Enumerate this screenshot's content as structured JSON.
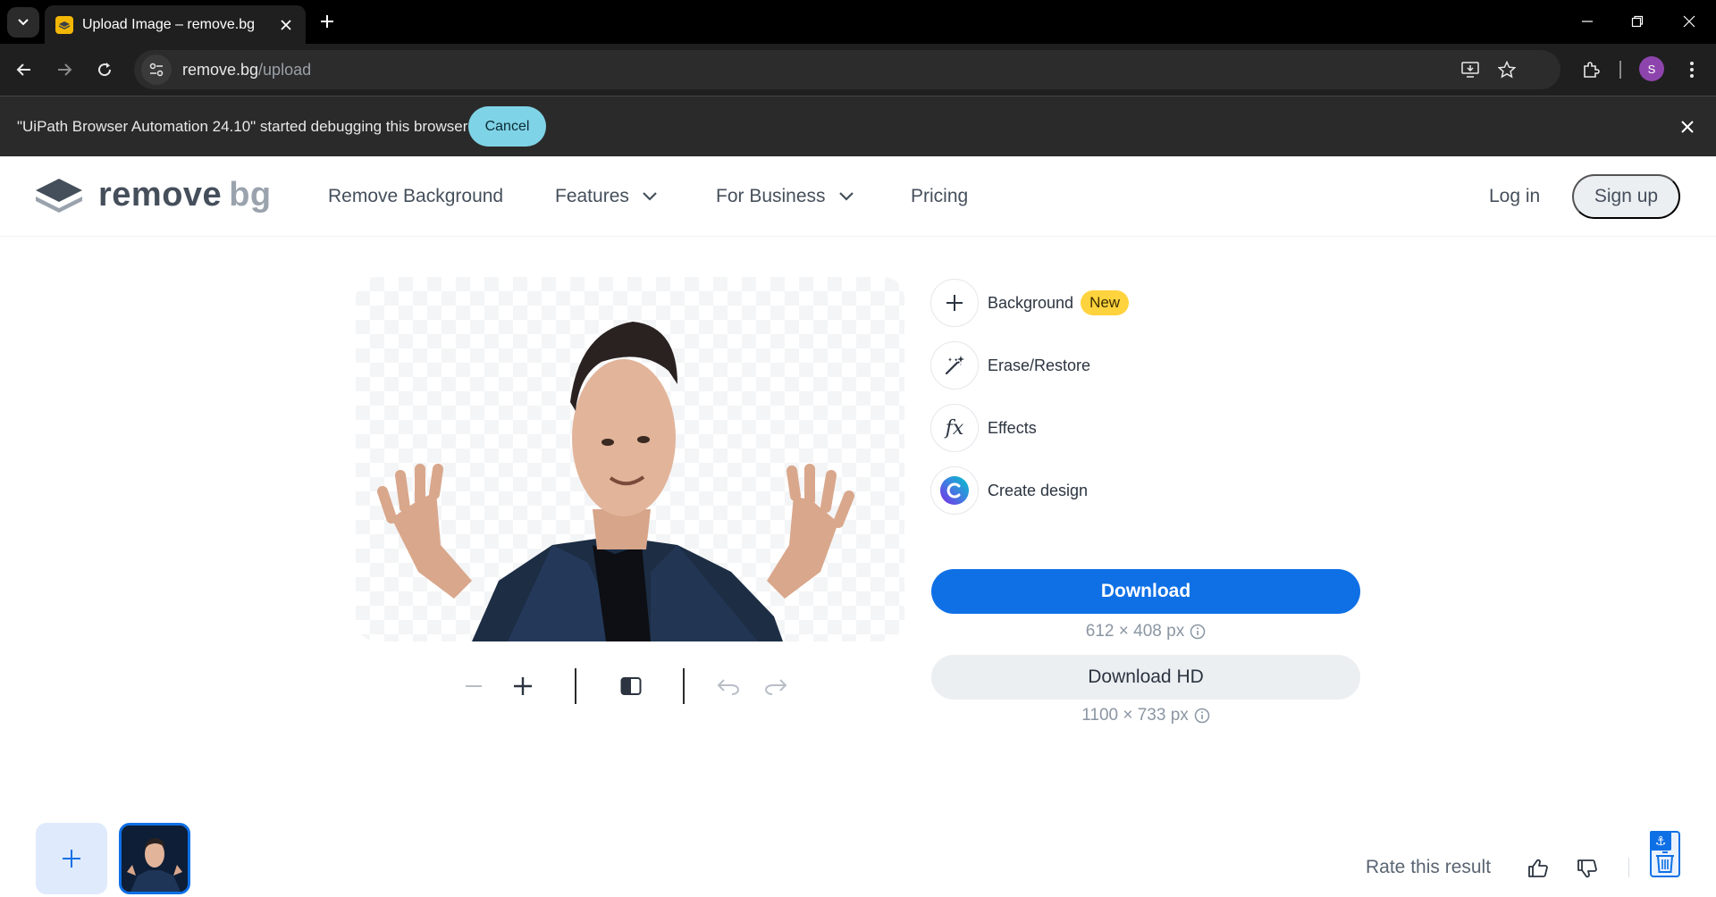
{
  "browser": {
    "tab_title": "Upload Image – remove.bg",
    "url_host": "remove.bg",
    "url_path": "/upload",
    "profile_initial": "S"
  },
  "infobar": {
    "message": "\"UiPath Browser Automation 24.10\" started debugging this browser",
    "cancel_label": "Cancel"
  },
  "site": {
    "logo_word1": "remove",
    "logo_word2": "bg",
    "nav": {
      "remove_background": "Remove Background",
      "features": "Features",
      "for_business": "For Business",
      "pricing": "Pricing"
    },
    "login": "Log in",
    "signup": "Sign up"
  },
  "editor": {
    "tools": {
      "background": "Background",
      "new_badge": "New",
      "erase_restore": "Erase/Restore",
      "effects": "Effects",
      "create_design": "Create design"
    },
    "download_label": "Download",
    "download_size": "612 × 408 px",
    "download_hd_label": "Download HD",
    "download_hd_size": "1100 × 733 px"
  },
  "footer": {
    "rate_text": "Rate this result"
  },
  "colors": {
    "accent": "#0f70e6",
    "badge": "#ffd33d",
    "infobar_button": "#7fd3e6"
  }
}
